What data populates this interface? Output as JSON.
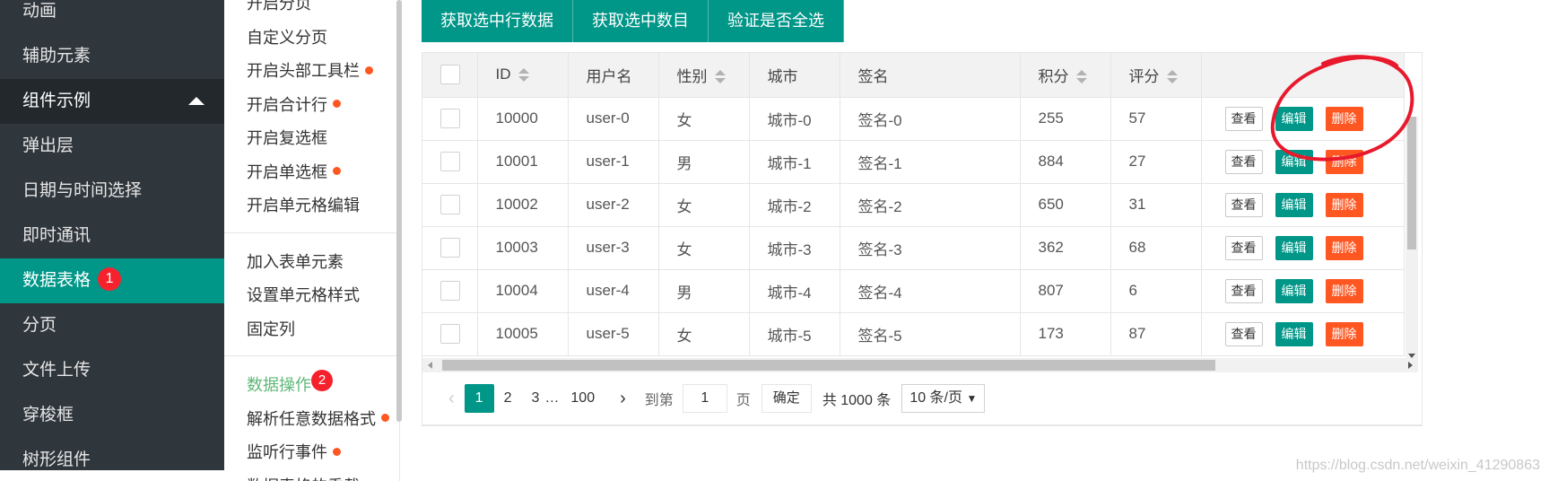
{
  "nav": {
    "items": [
      {
        "label": "动画"
      },
      {
        "label": "辅助元素"
      },
      {
        "label": "组件示例"
      },
      {
        "label": "弹出层"
      },
      {
        "label": "日期与时间选择"
      },
      {
        "label": "即时通讯"
      },
      {
        "label": "数据表格",
        "badge": "1"
      },
      {
        "label": "分页"
      },
      {
        "label": "文件上传"
      },
      {
        "label": "穿梭框"
      },
      {
        "label": "树形组件"
      }
    ]
  },
  "submenu": {
    "group1": [
      "开启分页",
      "自定义分页",
      "开启头部工具栏",
      "开启合计行",
      "开启复选框",
      "开启单选框",
      "开启单元格编辑"
    ],
    "group2": [
      "加入表单元素",
      "设置单元格样式",
      "固定列"
    ],
    "group3": [
      "数据操作",
      "解析任意数据格式",
      "监听行事件",
      "数据表格的重载"
    ],
    "badge": "2"
  },
  "toolbar": {
    "buttons": [
      "获取选中行数据",
      "获取选中数目",
      "验证是否全选"
    ]
  },
  "table": {
    "headers": [
      "ID",
      "用户名",
      "性别",
      "城市",
      "签名",
      "积分",
      "评分"
    ],
    "actions": {
      "view": "查看",
      "edit": "编辑",
      "delete": "删除"
    },
    "rows": [
      {
        "id": "10000",
        "user": "user-0",
        "sex": "女",
        "city": "城市-0",
        "sign": "签名-0",
        "score": "255",
        "rating": "57"
      },
      {
        "id": "10001",
        "user": "user-1",
        "sex": "男",
        "city": "城市-1",
        "sign": "签名-1",
        "score": "884",
        "rating": "27"
      },
      {
        "id": "10002",
        "user": "user-2",
        "sex": "女",
        "city": "城市-2",
        "sign": "签名-2",
        "score": "650",
        "rating": "31"
      },
      {
        "id": "10003",
        "user": "user-3",
        "sex": "女",
        "city": "城市-3",
        "sign": "签名-3",
        "score": "362",
        "rating": "68"
      },
      {
        "id": "10004",
        "user": "user-4",
        "sex": "男",
        "city": "城市-4",
        "sign": "签名-4",
        "score": "807",
        "rating": "6"
      },
      {
        "id": "10005",
        "user": "user-5",
        "sex": "女",
        "city": "城市-5",
        "sign": "签名-5",
        "score": "173",
        "rating": "87"
      }
    ]
  },
  "pager": {
    "pages": [
      "1",
      "2",
      "3",
      "…",
      "100"
    ],
    "goto_label": "到第",
    "goto_value": "1",
    "page_label": "页",
    "confirm": "确定",
    "total": "共 1000 条",
    "per_page": "10 条/页"
  },
  "watermark": "https://blog.csdn.net/weixin_41290863",
  "colors": {
    "accent": "#009688",
    "danger": "#ff5722",
    "annotation": "#e8192c"
  }
}
